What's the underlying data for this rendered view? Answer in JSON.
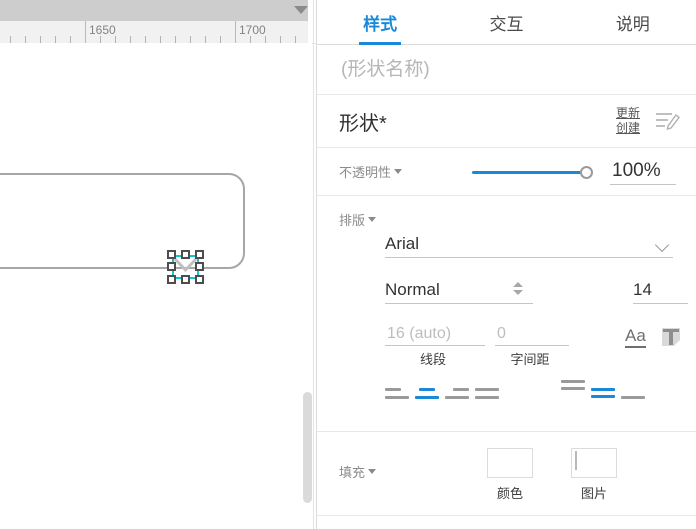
{
  "canvas": {
    "toolbar": {
      "dropdown_icon": "chevron-down-icon"
    },
    "ruler": {
      "unit_labels": [
        "1650",
        "1700"
      ],
      "major_positions": [
        85,
        235
      ],
      "minor_step": 15
    },
    "shape": {
      "type": "rounded-rectangle"
    },
    "selection": {
      "handles": 8,
      "guide_color": "#12c4d6"
    },
    "scrollbar": {
      "orientation": "vertical"
    }
  },
  "panel": {
    "tabs": [
      {
        "label": "样式",
        "active": true
      },
      {
        "label": "交互",
        "active": false
      },
      {
        "label": "说明",
        "active": false
      }
    ],
    "shape_name": {
      "value": "",
      "placeholder": "(形状名称)"
    },
    "style": {
      "name": "形状*",
      "update_label": "更新",
      "create_label": "创建",
      "edit_icon": "edit-style-icon"
    },
    "opacity": {
      "label": "不透明性",
      "value": "100%",
      "slider_percent": 100,
      "accent": "#1a8ad8"
    },
    "typography": {
      "label": "排版",
      "font_family": "Arial",
      "font_weight": "Normal",
      "font_size": "14",
      "font_color": "#969696",
      "line_spacing": {
        "value": "16 (auto)",
        "caption": "线段"
      },
      "letter_spacing": {
        "value": "0",
        "caption": "字间距"
      },
      "underline_icon": "underline-Aa-icon",
      "text_shadow_icon": "text-T-icon",
      "h_align": {
        "options": [
          "align-left",
          "align-center",
          "align-right",
          "align-justify"
        ],
        "selected": 1
      },
      "v_align": {
        "options": [
          "align-top",
          "align-middle",
          "align-bottom"
        ],
        "selected": 1
      }
    },
    "fill": {
      "label": "填充",
      "items": [
        {
          "caption": "颜色",
          "icon": "fill-color-swatch",
          "color": "#969696"
        },
        {
          "caption": "图片",
          "icon": "fill-image-icon"
        }
      ]
    }
  }
}
